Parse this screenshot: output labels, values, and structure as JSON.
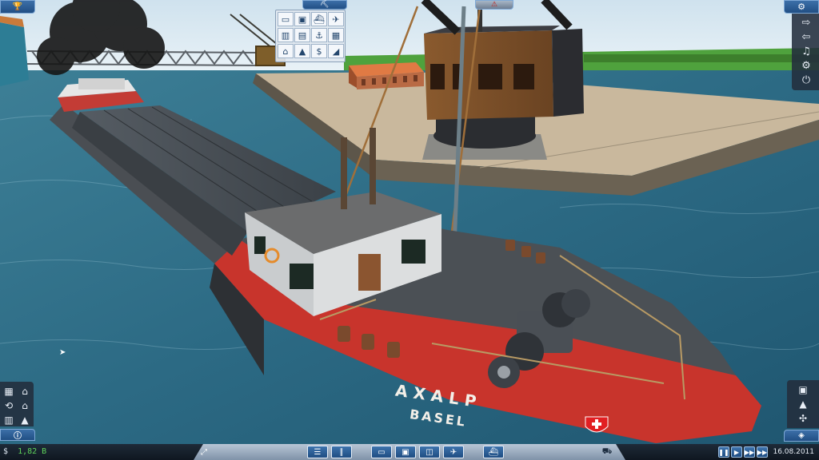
{
  "ship": {
    "name": "AXALP",
    "home_port": "BASEL"
  },
  "status_bar": {
    "money": "1,82 B",
    "currency_symbol": "$",
    "date": "16.08.2011"
  },
  "hud": {
    "top_left_icon": "trophy-icon",
    "top_center_icon": "bulldozer-icon",
    "warning_icon": "warning-icon",
    "top_right_icon": "gear-icon",
    "info_icon": "info-icon",
    "layers_icon": "layers-icon"
  },
  "right_menu": [
    {
      "name": "save-icon"
    },
    {
      "name": "load-icon"
    },
    {
      "name": "music-icon"
    },
    {
      "name": "settings-icon"
    },
    {
      "name": "power-icon"
    }
  ],
  "build_menu": [
    "road-icon",
    "bus-icon",
    "ship-icon",
    "plane-icon",
    "train-station-icon",
    "truck-station-icon",
    "harbor-icon",
    "airport-icon",
    "factory-icon",
    "industry-icon",
    "money-icon",
    "terrain-icon"
  ],
  "bottom_buttons": [
    "rail-icon",
    "road-icon",
    "train-icon",
    "bus-icon",
    "tram-icon",
    "plane-icon",
    "ship-icon",
    "construction-icon"
  ],
  "speed_controls": [
    "pause-icon",
    "play-icon",
    "fast-forward-icon",
    "fastest-icon"
  ],
  "colors": {
    "hud_blue": "#2a5a92",
    "hull_red": "#c8342c",
    "money_green": "#5fd35a"
  }
}
